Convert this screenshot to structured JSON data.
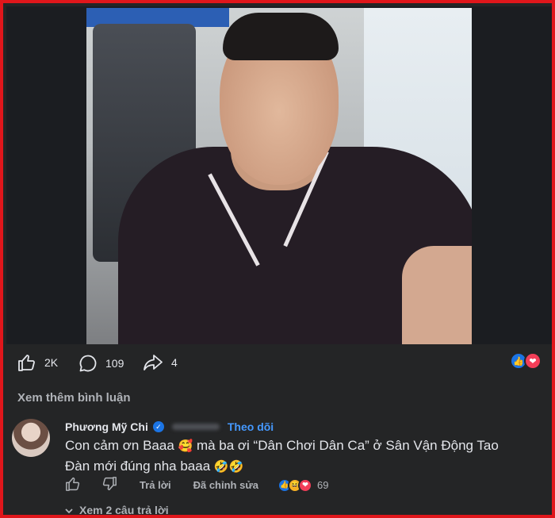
{
  "post": {
    "stats": {
      "likes": "2K",
      "comments": "109",
      "shares": "4"
    },
    "icons": {
      "like": "thumbs-up-icon",
      "comment": "comment-bubble-icon",
      "share": "share-arrow-icon"
    },
    "reaction_icons": [
      "like-reaction-icon",
      "love-reaction-icon"
    ]
  },
  "comments_section": {
    "view_more": "Xem thêm bình luận"
  },
  "comment": {
    "author": "Phương Mỹ Chi",
    "follow_label": "Theo dõi",
    "text_part1": "Con cảm ơn Baaa",
    "text_part2": "mà ba ơi “Dân Chơi Dân Ca” ở Sân Vận Động Tao Đàn mới đúng nha baaa",
    "reply_label": "Trả lời",
    "edited_label": "Đã chỉnh sửa",
    "reaction_count": "69",
    "view_replies": "Xem 2 câu trả lời"
  },
  "colors": {
    "background": "#242526",
    "border": "#e0161b",
    "accent": "#4599ff",
    "like_blue": "#1b74e4",
    "love_red": "#f33e58"
  }
}
